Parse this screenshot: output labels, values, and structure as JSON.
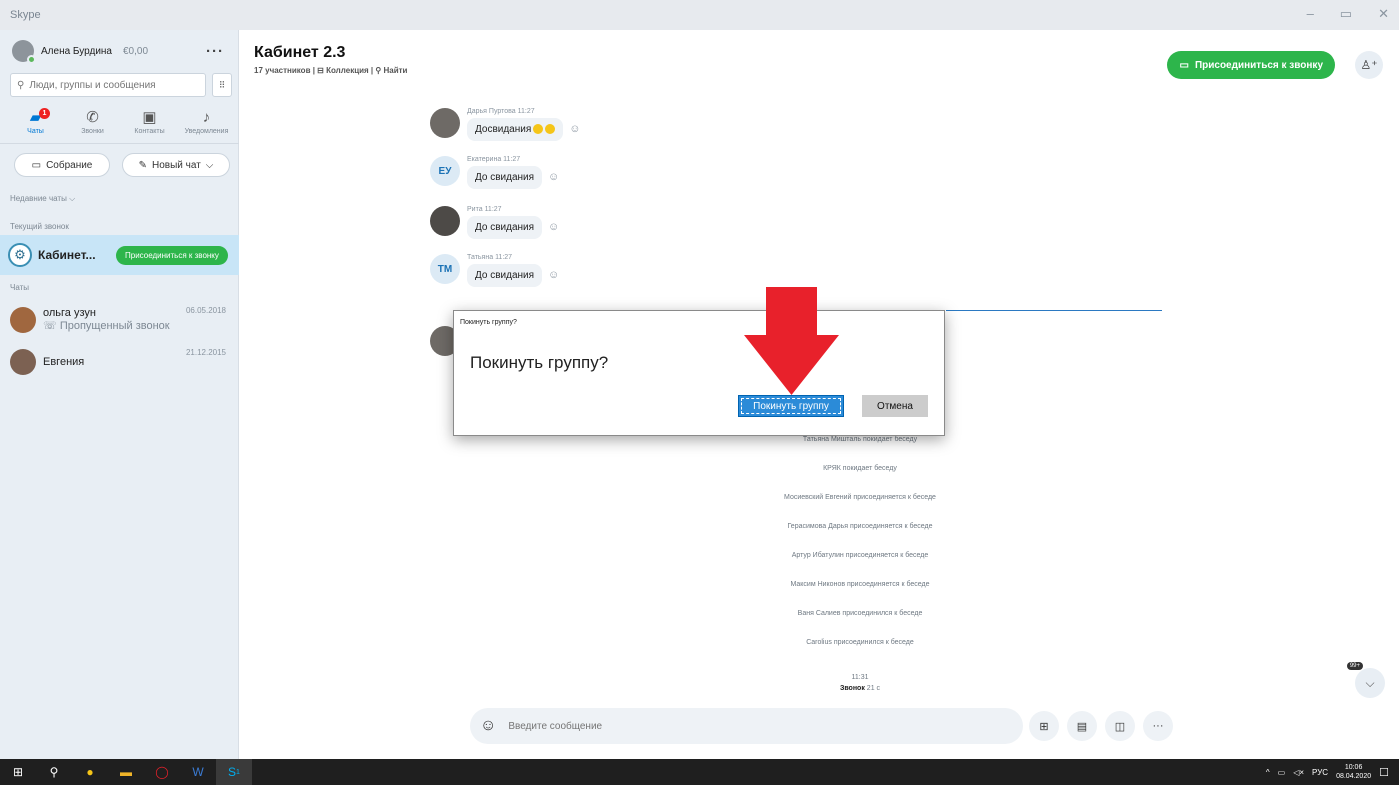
{
  "window": {
    "title": "Skype"
  },
  "profile": {
    "name": "Алена Бурдина",
    "credit": "€0,00",
    "menu": "···"
  },
  "search": {
    "placeholder": "Люди, группы и сообщения"
  },
  "nav": [
    {
      "label": "Чаты",
      "icon": "chat-icon",
      "badge": "1"
    },
    {
      "label": "Звонки",
      "icon": "phone-icon"
    },
    {
      "label": "Контакты",
      "icon": "contacts-icon"
    },
    {
      "label": "Уведомления",
      "icon": "bell-icon"
    }
  ],
  "actions": {
    "meeting": "Собрание",
    "new_chat": "Новый чат"
  },
  "sections": {
    "recent": "Недавние чаты",
    "current_call": "Текущий звонок",
    "chats": "Чаты"
  },
  "current_call": {
    "title": "Кабинет...",
    "join": "Присоединиться к звонку"
  },
  "chats": [
    {
      "name": "ольга узун",
      "sub": "Пропущенный звонок",
      "date": "06.05.2018"
    },
    {
      "name": "Евгения",
      "sub": "",
      "date": "21.12.2015"
    }
  ],
  "header": {
    "title": "Кабинет 2.3",
    "participants": "17 участников",
    "gallery": "Коллекция",
    "find": "Найти",
    "join_call": "Присоединиться к звонку"
  },
  "messages": [
    {
      "author": "Дарья Пуртова",
      "time": "11:27",
      "text": "Досвидания",
      "avatar": "photo"
    },
    {
      "author": "Екатерина",
      "time": "11:27",
      "text": "До свидания",
      "avatar": "ЕУ"
    },
    {
      "author": "Рита",
      "time": "11:27",
      "text": "До свидания",
      "avatar": "photo"
    },
    {
      "author": "Татьяна",
      "time": "11:27",
      "text": "До свидания",
      "avatar": "ТМ"
    }
  ],
  "system_messages": [
    "Татьяна Мишталь покидает беседу",
    "КРЯК покидает беседу",
    "Мосиевский Евгений присоединяется к беседе",
    "Герасимова Дарья присоединяется к беседе",
    "Артур Ибатулин присоединяется к беседе",
    "Максим Никонов присоединяется к беседе",
    "Ваня Салиев присоединился к беседе",
    "Carolius присоединился к беседе"
  ],
  "call_log": {
    "time": "11:31",
    "label": "Звонок",
    "duration": "21 с"
  },
  "scroll_badge": "99+",
  "composer": {
    "placeholder": "Введите сообщение"
  },
  "dialog": {
    "title": "Покинуть группу?",
    "question": "Покинуть группу?",
    "confirm": "Покинуть группу",
    "cancel": "Отмена"
  },
  "taskbar": {
    "lang": "РУС",
    "time": "10:06",
    "date": "08.04.2020",
    "skype_badge": "1"
  },
  "colors": {
    "accent": "#0078d4",
    "green": "#2db54b",
    "arrow": "#e8212b"
  }
}
